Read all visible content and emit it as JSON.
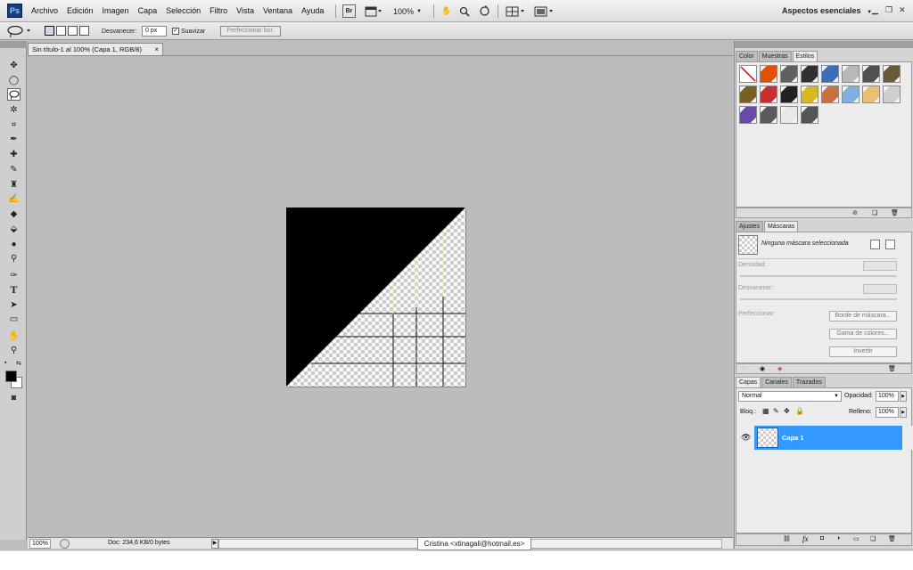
{
  "app": {
    "logo": "Ps",
    "workspace": "Aspectos esenciales",
    "workspace_arrow": "▼"
  },
  "menu": [
    "Archivo",
    "Edición",
    "Imagen",
    "Capa",
    "Selección",
    "Filtro",
    "Vista",
    "Ventana",
    "Ayuda"
  ],
  "menubar": {
    "bridge": "Br",
    "zoom": "100%"
  },
  "options": {
    "feather_label": "Desvanecer:",
    "feather_value": "0 px",
    "smooth_label": "Suavizar",
    "smooth_checked": true,
    "refine_label": "Perfeccionar bor."
  },
  "document": {
    "tab_title": "Sin título-1 al 100% (Capa 1, RGB/8)",
    "close": "×"
  },
  "status": {
    "zoom": "100%",
    "doc_size": "Doc: 234,6 KB/0 bytes"
  },
  "credit": "Cristina <xtinagali@hotmail.es>",
  "styles_panel": {
    "tabs": [
      "Color",
      "Muestras",
      "Estilos"
    ],
    "active_tab": "Estilos",
    "swatches": [
      "#ffffff",
      "#e25000",
      "#606060",
      "#303030",
      "#3a6fb8",
      "#b8b8b8",
      "#505050",
      "#6a5a3a",
      "#7a6020",
      "#c83030",
      "#222222",
      "#d8b820",
      "#c87040",
      "#80b0e0",
      "#e8c070",
      "#cfcfcf",
      "#6a4aa8",
      "#5a5a5a",
      "#e8e8e8",
      "#555555"
    ]
  },
  "masks_panel": {
    "tabs": [
      "Ajustes",
      "Máscaras"
    ],
    "active_tab": "Máscaras",
    "none_selected": "Ninguna máscara seleccionada",
    "density": "Densidad:",
    "feather": "Desvanecer:",
    "refine": "Perfeccionar:",
    "mask_edge": "Borde de máscara...",
    "color_range": "Gama de colores...",
    "invert": "Invertir"
  },
  "layers_panel": {
    "tabs": [
      "Capas",
      "Canales",
      "Trazados"
    ],
    "active_tab": "Capas",
    "blend_mode": "Normal",
    "opacity_label": "Opacidad:",
    "opacity": "100%",
    "lock_label": "Bloq.:",
    "fill_label": "Relleno:",
    "fill": "100%",
    "layers": [
      {
        "name": "Capa 1",
        "visible": true,
        "selected": true
      }
    ]
  }
}
